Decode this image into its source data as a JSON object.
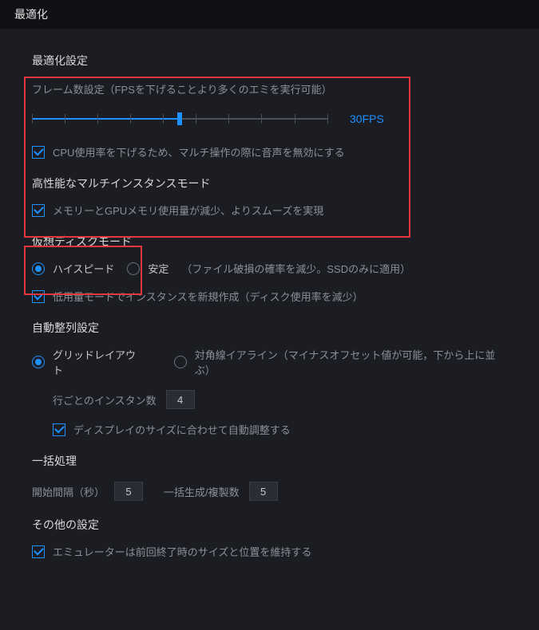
{
  "titlebar": {
    "title": "最適化"
  },
  "optimization": {
    "section_title": "最適化設定",
    "frame_desc": "フレーム数設定（FPSを下げることより多くのエミを実行可能）",
    "fps_value": "30FPS",
    "cpu_checkbox": "CPU使用率を下げるため、マルチ操作の際に音声を無効にする"
  },
  "multi_instance": {
    "title": "高性能なマルチインスタンスモード",
    "memory_checkbox": "メモリーとGPUメモリ使用量が減少、よりスムーズを実現"
  },
  "disk_mode": {
    "title": "仮想ディスクモード",
    "high_speed": "ハイスピード",
    "stable": "安定",
    "stable_note": "（ファイル破損の確率を減少。SSDのみに適用）",
    "low_usage": "低用量モードでインスタンスを新規作成（ディスク使用率を減少）"
  },
  "auto_align": {
    "title": "自動整列設定",
    "grid": "グリッドレイアウト",
    "diagonal": "対角線イアライン（マイナスオフセット値が可能，下から上に並ぶ）",
    "row_count_label": "行ごとのインスタン数",
    "row_count_value": "4",
    "auto_fit": "ディスプレイのサイズに合わせて自動調整する"
  },
  "batch": {
    "title": "一括処理",
    "interval_label": "開始間隔（秒）",
    "interval_value": "5",
    "count_label": "一括生成/複製数",
    "count_value": "5"
  },
  "other": {
    "title": "その他の設定",
    "keep_pos": "エミュレーターは前回終了時のサイズと位置を維持する"
  }
}
